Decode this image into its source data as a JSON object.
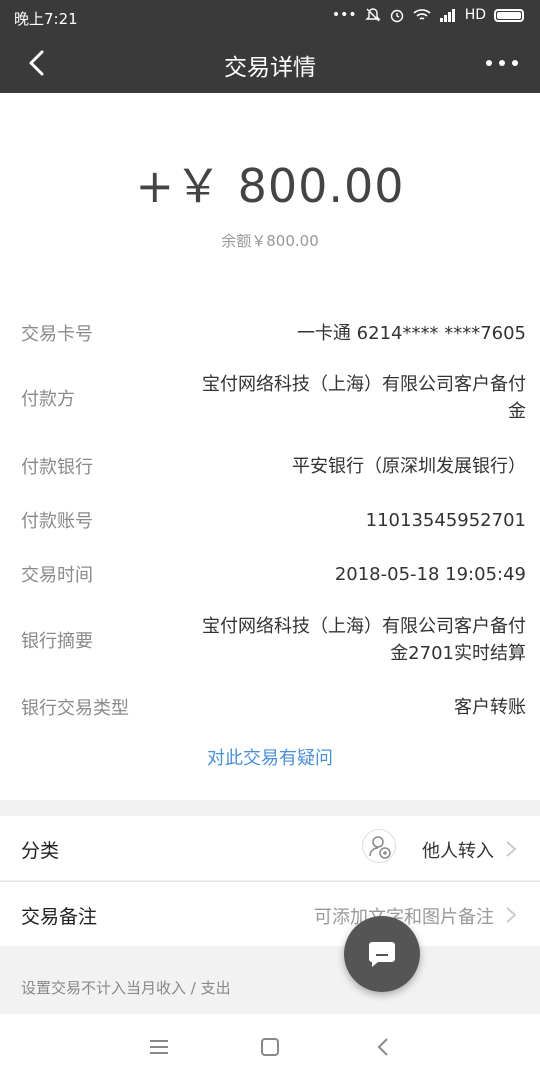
{
  "status_bar": {
    "time": "晚上7:21",
    "network": "HD"
  },
  "nav": {
    "title": "交易详情",
    "back_icon": "chevron-left-icon",
    "more_icon": "more-dots-icon"
  },
  "amount": {
    "value": "+￥ 800.00",
    "balance": "余额￥800.00"
  },
  "details": [
    {
      "label": "交易卡号",
      "value": "一卡通 6214**** ****7605"
    },
    {
      "label": "付款方",
      "value_line1": "宝付网络科技（上海）有限公司客户备付",
      "value_line2": "金"
    },
    {
      "label": "付款银行",
      "value": "平安银行（原深圳发展银行）"
    },
    {
      "label": "付款账号",
      "value": "11013545952701"
    },
    {
      "label": "交易时间",
      "value": "2018-05-18 19:05:49"
    },
    {
      "label": "银行摘要",
      "value_line1": "宝付网络科技（上海）有限公司客户备付",
      "value_line2": "金2701实时结算"
    },
    {
      "label": "银行交易类型",
      "value": "客户转账"
    }
  ],
  "doubt_link": "对此交易有疑问",
  "category": {
    "label": "分类",
    "value": "他人转入",
    "icon": "person-transfer-icon"
  },
  "note": {
    "label": "交易备注",
    "placeholder": "可添加文字和图片备注"
  },
  "exclude_text": "设置交易不计入当月收入 / 支出",
  "fab_icon": "chat-bubble-icon",
  "colors": {
    "header": "#3a3a3a",
    "link": "#4a90d9"
  }
}
